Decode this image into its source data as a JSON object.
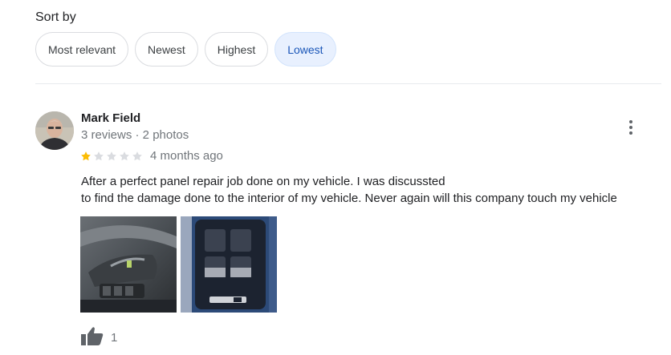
{
  "sort": {
    "label": "Sort by",
    "options": [
      "Most relevant",
      "Newest",
      "Highest",
      "Lowest"
    ],
    "selected": "Lowest"
  },
  "review": {
    "author": "Mark Field",
    "meta": "3 reviews · 2 photos",
    "rating": 1,
    "rating_max": 5,
    "date": "4 months ago",
    "text_lines": [
      "After a perfect panel repair job done on my vehicle. I was discussted",
      "to find the damage done to the interior of my vehicle. Never again will this company touch my vehicle"
    ],
    "photos": [
      "door-interior-photo",
      "window-switch-panel-photo"
    ],
    "likes": "1"
  },
  "colors": {
    "accent": "#1a56b8",
    "chip_active_bg": "#e8f0fe",
    "star_filled": "#fbbc04",
    "star_empty": "#dadce0"
  }
}
